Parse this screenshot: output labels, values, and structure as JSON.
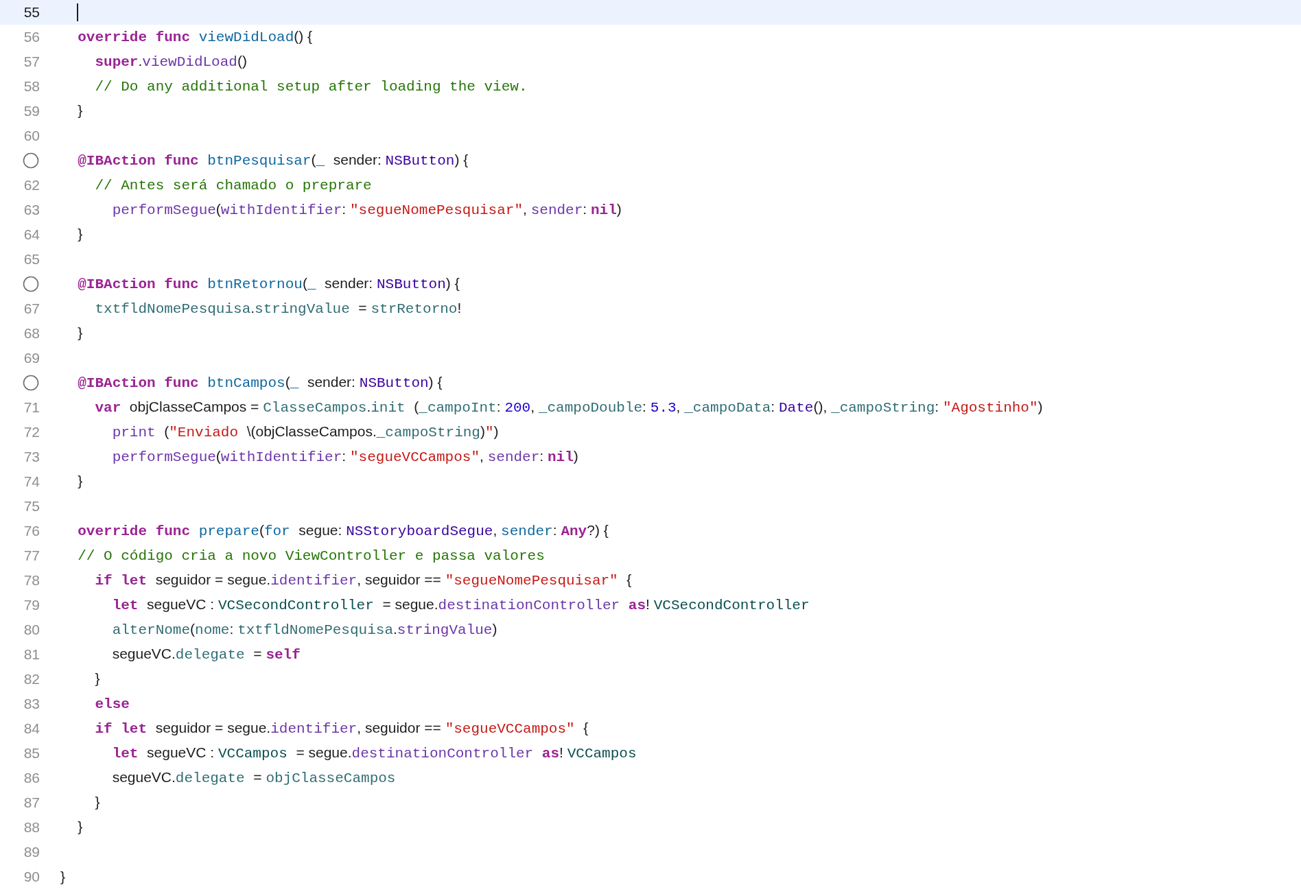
{
  "editor": {
    "lines": [
      {
        "number": "55",
        "current": true
      },
      {
        "number": "56",
        "current": false,
        "tokens": [
          {
            "kind": "keyword",
            "text": "  override func "
          },
          {
            "kind": "declaration",
            "text": "viewDidLoad"
          },
          {
            "kind": "plain",
            "text": "() {"
          }
        ]
      },
      {
        "number": "57",
        "current": false,
        "tokens": [
          {
            "kind": "keyword",
            "text": "    super"
          },
          {
            "kind": "plain",
            "text": "."
          },
          {
            "kind": "system",
            "text": "viewDidLoad"
          },
          {
            "kind": "plain",
            "text": "()"
          }
        ]
      },
      {
        "number": "58",
        "current": false,
        "tokens": [
          {
            "kind": "comment",
            "text": "    // Do any additional setup after loading the view."
          }
        ]
      },
      {
        "number": "59",
        "current": false,
        "tokens": [
          {
            "kind": "plain",
            "text": "  }"
          }
        ]
      },
      {
        "number": "60",
        "current": false
      },
      {
        "kind": "connection",
        "current": false,
        "tokens": [
          {
            "kind": "keyword",
            "text": "  @IBAction func "
          },
          {
            "kind": "declaration",
            "text": "btnPesquisar"
          },
          {
            "kind": "plain",
            "text": "("
          },
          {
            "kind": "declaration",
            "text": "_"
          },
          {
            "kind": "plain",
            "text": " sender: "
          },
          {
            "kind": "type",
            "text": "NSButton"
          },
          {
            "kind": "plain",
            "text": ") {"
          }
        ]
      },
      {
        "number": "62",
        "current": false,
        "tokens": [
          {
            "kind": "comment",
            "text": "    // Antes será chamado o preprare"
          }
        ]
      },
      {
        "number": "63",
        "current": false,
        "tokens": [
          {
            "kind": "system",
            "text": "      performSegue"
          },
          {
            "kind": "plain",
            "text": "("
          },
          {
            "kind": "system",
            "text": "withIdentifier"
          },
          {
            "kind": "plain",
            "text": ": "
          },
          {
            "kind": "string",
            "text": "\"segueNomePesquisar\""
          },
          {
            "kind": "plain",
            "text": ", "
          },
          {
            "kind": "system",
            "text": "sender"
          },
          {
            "kind": "plain",
            "text": ": "
          },
          {
            "kind": "keyword",
            "text": "nil"
          },
          {
            "kind": "plain",
            "text": ")"
          }
        ]
      },
      {
        "number": "64",
        "current": false,
        "tokens": [
          {
            "kind": "plain",
            "text": "  }"
          }
        ]
      },
      {
        "number": "65",
        "current": false
      },
      {
        "kind": "connection",
        "current": false,
        "tokens": [
          {
            "kind": "keyword",
            "text": "  @IBAction func "
          },
          {
            "kind": "declaration",
            "text": "btnRetornou"
          },
          {
            "kind": "plain",
            "text": "("
          },
          {
            "kind": "declaration",
            "text": "_"
          },
          {
            "kind": "plain",
            "text": " sender: "
          },
          {
            "kind": "type",
            "text": "NSButton"
          },
          {
            "kind": "plain",
            "text": ") {"
          }
        ]
      },
      {
        "number": "67",
        "current": false,
        "tokens": [
          {
            "kind": "project",
            "text": "    txtfldNomePesquisa"
          },
          {
            "kind": "plain",
            "text": "."
          },
          {
            "kind": "project",
            "text": "stringValue"
          },
          {
            "kind": "plain",
            "text": " = "
          },
          {
            "kind": "project",
            "text": "strRetorno"
          },
          {
            "kind": "plain",
            "text": "!"
          }
        ]
      },
      {
        "number": "68",
        "current": false,
        "tokens": [
          {
            "kind": "plain",
            "text": "  }"
          }
        ]
      },
      {
        "number": "69",
        "current": false
      },
      {
        "kind": "connection",
        "current": false,
        "tokens": [
          {
            "kind": "keyword",
            "text": "  @IBAction func "
          },
          {
            "kind": "declaration",
            "text": "btnCampos"
          },
          {
            "kind": "plain",
            "text": "("
          },
          {
            "kind": "declaration",
            "text": "_"
          },
          {
            "kind": "plain",
            "text": " sender: "
          },
          {
            "kind": "type",
            "text": "NSButton"
          },
          {
            "kind": "plain",
            "text": ") {"
          }
        ]
      },
      {
        "number": "71",
        "current": false,
        "tokens": [
          {
            "kind": "keyword",
            "text": "    var "
          },
          {
            "kind": "plain",
            "text": "objClasseCampos = "
          },
          {
            "kind": "project",
            "text": "ClasseCampos"
          },
          {
            "kind": "plain",
            "text": "."
          },
          {
            "kind": "project",
            "text": "init"
          },
          {
            "kind": "plain",
            "text": " ("
          },
          {
            "kind": "project",
            "text": "_campoInt"
          },
          {
            "kind": "plain",
            "text": ": "
          },
          {
            "kind": "number",
            "text": "200"
          },
          {
            "kind": "plain",
            "text": ", "
          },
          {
            "kind": "project",
            "text": "_campoDouble"
          },
          {
            "kind": "plain",
            "text": ": "
          },
          {
            "kind": "number",
            "text": "5.3"
          },
          {
            "kind": "plain",
            "text": ", "
          },
          {
            "kind": "project",
            "text": "_campoData"
          },
          {
            "kind": "plain",
            "text": ": "
          },
          {
            "kind": "type",
            "text": "Date"
          },
          {
            "kind": "plain",
            "text": "(), "
          },
          {
            "kind": "project",
            "text": "_campoString"
          },
          {
            "kind": "plain",
            "text": ": "
          },
          {
            "kind": "string",
            "text": "\"Agostinho\""
          },
          {
            "kind": "plain",
            "text": ")"
          }
        ]
      },
      {
        "number": "72",
        "current": false,
        "tokens": [
          {
            "kind": "system",
            "text": "      print"
          },
          {
            "kind": "plain",
            "text": " ("
          },
          {
            "kind": "string",
            "text": "\"Enviado "
          },
          {
            "kind": "plain",
            "text": "\\(objClasseCampos."
          },
          {
            "kind": "project",
            "text": "_campoString"
          },
          {
            "kind": "plain",
            "text": ")"
          },
          {
            "kind": "string",
            "text": "\""
          },
          {
            "kind": "plain",
            "text": ")"
          }
        ]
      },
      {
        "number": "73",
        "current": false,
        "tokens": [
          {
            "kind": "system",
            "text": "      performSegue"
          },
          {
            "kind": "plain",
            "text": "("
          },
          {
            "kind": "system",
            "text": "withIdentifier"
          },
          {
            "kind": "plain",
            "text": ": "
          },
          {
            "kind": "string",
            "text": "\"segueVCCampos\""
          },
          {
            "kind": "plain",
            "text": ", "
          },
          {
            "kind": "system",
            "text": "sender"
          },
          {
            "kind": "plain",
            "text": ": "
          },
          {
            "kind": "keyword",
            "text": "nil"
          },
          {
            "kind": "plain",
            "text": ")"
          }
        ]
      },
      {
        "number": "74",
        "current": false,
        "tokens": [
          {
            "kind": "plain",
            "text": "  }"
          }
        ]
      },
      {
        "number": "75",
        "current": false
      },
      {
        "number": "76",
        "current": false,
        "tokens": [
          {
            "kind": "keyword",
            "text": "  override func "
          },
          {
            "kind": "declaration",
            "text": "prepare"
          },
          {
            "kind": "plain",
            "text": "("
          },
          {
            "kind": "declaration",
            "text": "for"
          },
          {
            "kind": "plain",
            "text": " segue: "
          },
          {
            "kind": "type",
            "text": "NSStoryboardSegue"
          },
          {
            "kind": "plain",
            "text": ", "
          },
          {
            "kind": "declaration",
            "text": "sender"
          },
          {
            "kind": "plain",
            "text": ": "
          },
          {
            "kind": "keyword",
            "text": "Any"
          },
          {
            "kind": "plain",
            "text": "?) {"
          }
        ]
      },
      {
        "number": "77",
        "current": false,
        "tokens": [
          {
            "kind": "comment",
            "text": "  // O código cria a novo ViewController e passa valores"
          }
        ]
      },
      {
        "number": "78",
        "current": false,
        "tokens": [
          {
            "kind": "keyword",
            "text": "    if let "
          },
          {
            "kind": "plain",
            "text": "seguidor = segue."
          },
          {
            "kind": "system",
            "text": "identifier"
          },
          {
            "kind": "plain",
            "text": ", seguidor == "
          },
          {
            "kind": "string",
            "text": "\"segueNomePesquisar\""
          },
          {
            "kind": "plain",
            "text": " {"
          }
        ]
      },
      {
        "number": "79",
        "current": false,
        "tokens": [
          {
            "kind": "keyword",
            "text": "      let "
          },
          {
            "kind": "plain",
            "text": "segueVC : "
          },
          {
            "kind": "class",
            "text": "VCSecondController"
          },
          {
            "kind": "plain",
            "text": " = segue."
          },
          {
            "kind": "system",
            "text": "destinationController"
          },
          {
            "kind": "keyword",
            "text": " as"
          },
          {
            "kind": "plain",
            "text": "! "
          },
          {
            "kind": "class",
            "text": "VCSecondController"
          }
        ]
      },
      {
        "number": "80",
        "current": false,
        "tokens": [
          {
            "kind": "project",
            "text": "      alterNome"
          },
          {
            "kind": "plain",
            "text": "("
          },
          {
            "kind": "project",
            "text": "nome"
          },
          {
            "kind": "plain",
            "text": ": "
          },
          {
            "kind": "project",
            "text": "txtfldNomePesquisa"
          },
          {
            "kind": "plain",
            "text": "."
          },
          {
            "kind": "system",
            "text": "stringValue"
          },
          {
            "kind": "plain",
            "text": ")"
          }
        ]
      },
      {
        "number": "81",
        "current": false,
        "tokens": [
          {
            "kind": "plain",
            "text": "      segueVC."
          },
          {
            "kind": "project",
            "text": "delegate"
          },
          {
            "kind": "plain",
            "text": " = "
          },
          {
            "kind": "keyword",
            "text": "self"
          }
        ]
      },
      {
        "number": "82",
        "current": false,
        "tokens": [
          {
            "kind": "plain",
            "text": "    }"
          }
        ]
      },
      {
        "number": "83",
        "current": false,
        "tokens": [
          {
            "kind": "keyword",
            "text": "    else"
          }
        ]
      },
      {
        "number": "84",
        "current": false,
        "tokens": [
          {
            "kind": "keyword",
            "text": "    if let "
          },
          {
            "kind": "plain",
            "text": "seguidor = segue."
          },
          {
            "kind": "system",
            "text": "identifier"
          },
          {
            "kind": "plain",
            "text": ", seguidor == "
          },
          {
            "kind": "string",
            "text": "\"segueVCCampos\""
          },
          {
            "kind": "plain",
            "text": " {"
          }
        ]
      },
      {
        "number": "85",
        "current": false,
        "tokens": [
          {
            "kind": "keyword",
            "text": "      let "
          },
          {
            "kind": "plain",
            "text": "segueVC : "
          },
          {
            "kind": "class",
            "text": "VCCampos"
          },
          {
            "kind": "plain",
            "text": " = segue."
          },
          {
            "kind": "system",
            "text": "destinationController"
          },
          {
            "kind": "keyword",
            "text": " as"
          },
          {
            "kind": "plain",
            "text": "! "
          },
          {
            "kind": "class",
            "text": "VCCampos"
          }
        ]
      },
      {
        "number": "86",
        "current": false,
        "tokens": [
          {
            "kind": "plain",
            "text": "      segueVC."
          },
          {
            "kind": "project",
            "text": "delegate"
          },
          {
            "kind": "plain",
            "text": " = "
          },
          {
            "kind": "project",
            "text": "objClasseCampos"
          }
        ]
      },
      {
        "number": "87",
        "current": false,
        "tokens": [
          {
            "kind": "plain",
            "text": "    }"
          }
        ]
      },
      {
        "number": "88",
        "current": false,
        "tokens": [
          {
            "kind": "plain",
            "text": "  }"
          }
        ]
      },
      {
        "number": "89",
        "current": false
      },
      {
        "number": "90",
        "current": false,
        "tokens": [
          {
            "kind": "plain",
            "text": "}"
          }
        ]
      }
    ]
  }
}
